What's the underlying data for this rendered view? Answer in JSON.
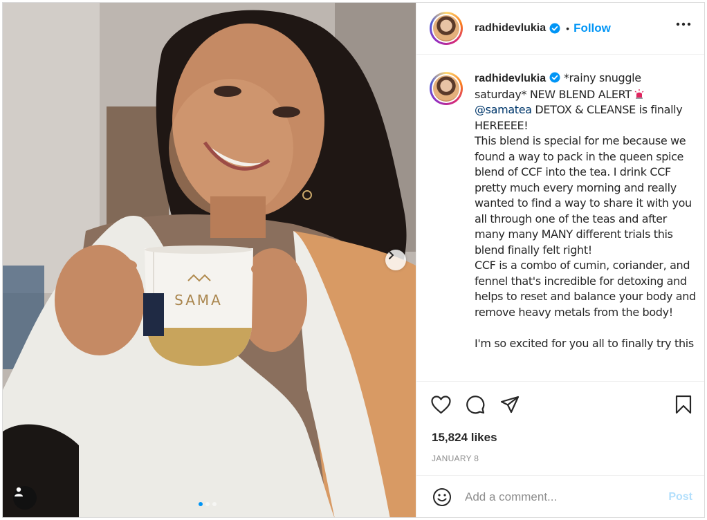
{
  "post": {
    "username": "radhidevlukia",
    "follow_label": "Follow",
    "separator": "•",
    "caption": {
      "username": "radhidevlukia",
      "text_1": " *rainy snuggle saturday* NEW BLEND ALERT",
      "mention": "@samatea",
      "text_2": " DETOX & CLEANSE is finally HEREEEE!\nThis blend is special for me because we found a way to pack in the queen spice blend of CCF into the tea. I drink CCF pretty much every morning and really wanted to find a way to share it with you all through one of the teas and after many many MANY different trials this blend finally felt right!\nCCF is a combo of cumin, coriander, and fennel that's incredible for detoxing and helps to reset and balance your body and remove heavy metals from the body!\n\nI'm so excited for you all to finally try this"
    },
    "likes": "15,824 likes",
    "date": "JANUARY 8",
    "comment_placeholder": "Add a comment...",
    "post_label": "Post",
    "mug_brand": "SAMA",
    "carousel": {
      "count": 3,
      "active": 0
    }
  },
  "icons": [
    "more-icon",
    "heart-icon",
    "comment-icon",
    "share-icon",
    "bookmark-icon",
    "emoji-icon",
    "chevron-right-icon",
    "user-tag-icon",
    "verified-icon",
    "siren-icon"
  ],
  "colors": {
    "link": "#0095f6",
    "mention": "#00376b",
    "muted": "#8e8e8e",
    "post_disabled": "#b2dffc"
  }
}
